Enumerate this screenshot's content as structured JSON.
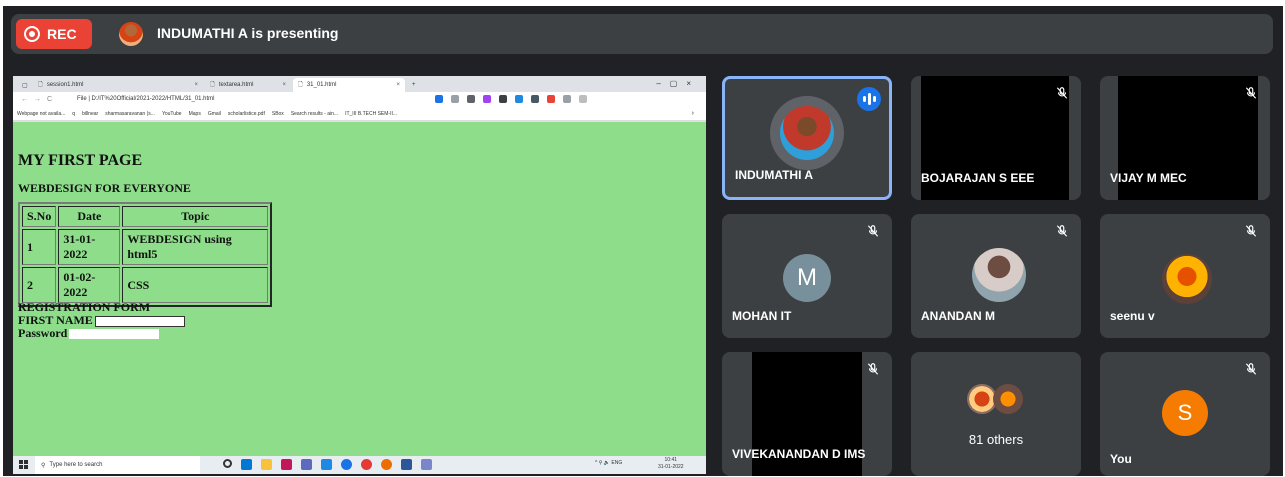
{
  "meeting": {
    "rec_label": "REC",
    "presenting_text": "INDUMATHI A is presenting"
  },
  "browser": {
    "tabs": [
      "session1.html",
      "textarea.html",
      "31_01.html"
    ],
    "new_tab": "+",
    "url": "File  |  D:/IT%20Official/2021-2022/HTML/31_01.html",
    "bookmarks": [
      "Webpage not availa...",
      "q",
      "billnear",
      "sharmasaravanan (s...",
      "YouTube",
      "Maps",
      "Gmail",
      "scholarlistice.pdf",
      "SBox",
      "Search results - ain...",
      "IT_III B.TECH SEM-II..."
    ]
  },
  "webpage": {
    "heading": "MY FIRST PAGE",
    "subheading": "WEBDESIGN FOR EVERYONE",
    "table": {
      "headers": [
        "S.No",
        "Date",
        "Topic"
      ],
      "rows": [
        [
          "1",
          "31-01-2022",
          "WEBDESIGN using html5"
        ],
        [
          "2",
          "01-02-2022",
          "CSS"
        ]
      ]
    },
    "form_title": "REGISTRATION FORM",
    "first_name_label": "FIRST NAME",
    "password_label": "Password"
  },
  "taskbar": {
    "search_placeholder": "Type here to search",
    "tray": "^ ⚲ 🔈 ENG",
    "time": "10:41",
    "date": "31-01-2022"
  },
  "participants": [
    {
      "name": "INDUMATHI A",
      "speaking": true
    },
    {
      "name": "BOJARAJAN S EEE",
      "muted": true
    },
    {
      "name": "VIJAY M MEC",
      "muted": true
    },
    {
      "name": "MOHAN IT",
      "initial": "M",
      "avatar_color": "#78909c",
      "muted": true
    },
    {
      "name": "ANANDAN M",
      "muted": true
    },
    {
      "name": "seenu v",
      "muted": true
    },
    {
      "name": "VIVEKANANDAN D IMS",
      "muted": true
    },
    {
      "name": "81 others"
    },
    {
      "name": "You",
      "initial": "S",
      "avatar_color": "#f57c00",
      "muted": true
    }
  ],
  "colors": {
    "rec": "#ea4335",
    "page_bg": "#8ddd8a",
    "active_speaker_border": "#8ab4f8",
    "tile_bg": "#3c4043",
    "meet_bg": "#202124"
  }
}
